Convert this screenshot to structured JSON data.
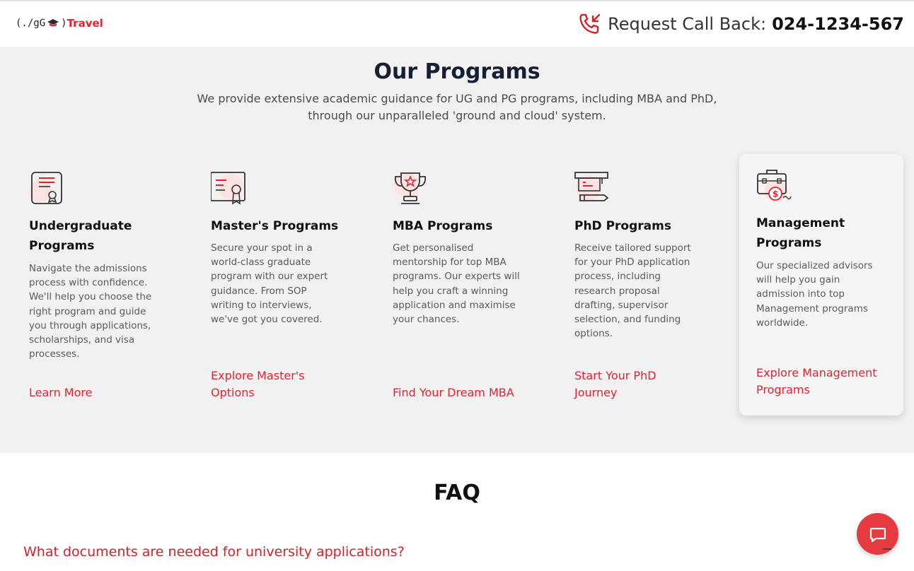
{
  "header": {
    "logo_code": "(./gG",
    "logo_paren": ")",
    "logo_brand": "Travel",
    "callback_label": "Request Call Back:",
    "callback_number": "024-1234-567"
  },
  "programs": {
    "title": "Our Programs",
    "subtitle_line1": "We provide extensive academic guidance for UG and PG programs, including MBA and PhD,",
    "subtitle_line2": "through our unparalleled 'ground and cloud' system.",
    "cards": [
      {
        "icon": "certificate-icon",
        "title": "Undergraduate Programs",
        "description": "Navigate the admissions process with confidence. We'll help you choose the right program and guide you through applications, scholarships, and visa processes.",
        "link": "Learn More"
      },
      {
        "icon": "diploma-icon",
        "title": "Master's Programs",
        "description": "Secure your spot in a world-class graduate program with our expert guidance. From SOP writing to interviews, we've got you covered.",
        "link": "Explore Master's Options"
      },
      {
        "icon": "trophy-icon",
        "title": "MBA Programs",
        "description": "Get personalised mentorship for top MBA programs. Our experts will help you craft a winning application and maximise your chances.",
        "link": "Find Your Dream MBA"
      },
      {
        "icon": "graduation-cap-pencil-icon",
        "title": "PhD Programs",
        "description": "Receive tailored support for your PhD application process, including research proposal drafting, supervisor selection, and funding options.",
        "link": "Start Your PhD Journey"
      },
      {
        "icon": "briefcase-money-icon",
        "title": "Management Programs",
        "description": "Our specialized advisors will help you gain admission into top Management programs worldwide.",
        "link": "Explore Management Programs"
      }
    ]
  },
  "faq": {
    "title": "FAQ",
    "questions": [
      "What documents are needed for university applications?"
    ]
  },
  "colors": {
    "accent": "#e0242f",
    "section_bg": "#f1f1f2",
    "chat_button": "#e53a3f"
  }
}
